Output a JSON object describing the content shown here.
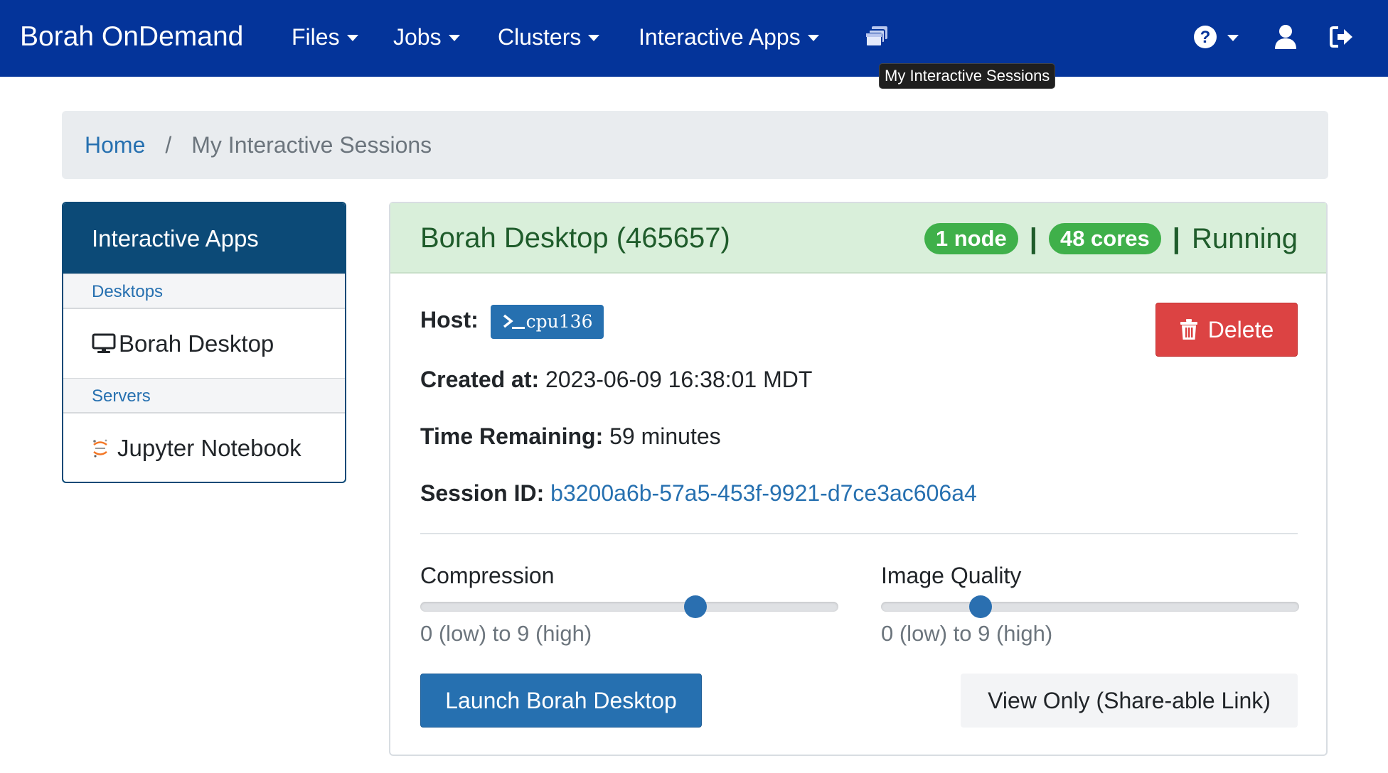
{
  "navbar": {
    "brand": "Borah OnDemand",
    "menus": [
      "Files",
      "Jobs",
      "Clusters",
      "Interactive Apps"
    ],
    "sessions_icon": "windows-stack-icon",
    "help_icon": "question-circle-icon",
    "user_icon": "user-icon",
    "logout_icon": "sign-out-icon",
    "bg_color": "#04349a"
  },
  "tooltip": {
    "text": "My Interactive Sessions"
  },
  "breadcrumb": {
    "home": "Home",
    "separator": "/",
    "current": "My Interactive Sessions"
  },
  "sidebar": {
    "title": "Interactive Apps",
    "groups": [
      {
        "category": "Desktops",
        "items": [
          {
            "label": "Borah Desktop",
            "icon": "desktop-monitor-icon"
          }
        ]
      },
      {
        "category": "Servers",
        "items": [
          {
            "label": "Jupyter Notebook",
            "icon": "jupyter-icon"
          }
        ]
      }
    ]
  },
  "session": {
    "title": "Borah Desktop (465657)",
    "nodes_badge": "1 node",
    "cores_badge": "48 cores",
    "separator": "|",
    "status": "Running",
    "host_label": "Host:",
    "host": "cpu136",
    "host_icon": "terminal-prompt-icon",
    "created_label": "Created at:",
    "created": "2023-06-09 16:38:01 MDT",
    "time_label": "Time Remaining:",
    "time_remaining": "59 minutes",
    "session_id_label": "Session ID:",
    "session_id": "b3200a6b-57a5-453f-9921-d7ce3ac606a4",
    "delete_label": "Delete",
    "delete_icon": "trash-icon",
    "compression": {
      "label": "Compression",
      "hint": "0 (low) to 9 (high)",
      "value": 6,
      "min": 0,
      "max": 9
    },
    "image_quality": {
      "label": "Image Quality",
      "hint": "0 (low) to 9 (high)",
      "value": 2,
      "min": 0,
      "max": 9
    },
    "launch_label": "Launch Borah Desktop",
    "view_only_label": "View Only (Share-able Link)"
  }
}
